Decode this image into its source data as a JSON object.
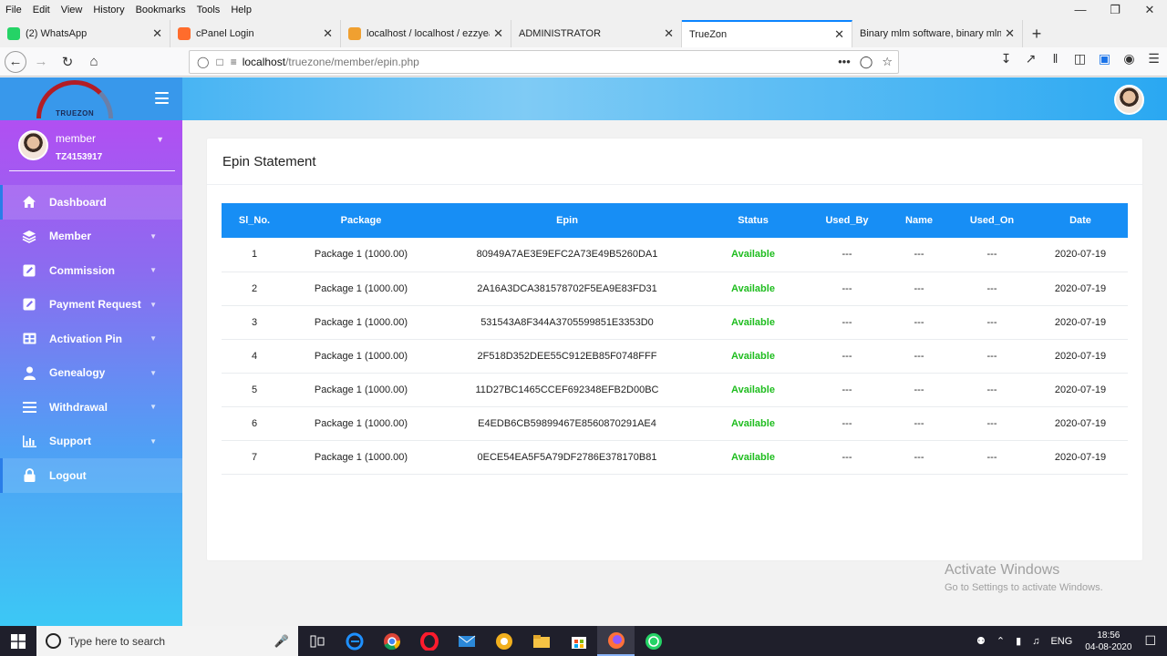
{
  "menubar": {
    "items": [
      "File",
      "Edit",
      "View",
      "History",
      "Bookmarks",
      "Tools",
      "Help"
    ]
  },
  "tabs": [
    {
      "label": "(2) WhatsApp",
      "icon": "whatsapp-icon",
      "color": "#25d366"
    },
    {
      "label": "cPanel Login",
      "icon": "cpanel-icon",
      "color": "#ff6c2c"
    },
    {
      "label": "localhost / localhost / ezzyeam",
      "icon": "phpmyadmin-icon",
      "color": "#f0a030"
    },
    {
      "label": "ADMINISTRATOR",
      "icon": "",
      "color": ""
    },
    {
      "label": "TrueZon",
      "icon": "",
      "color": ""
    },
    {
      "label": "Binary mlm software, binary mlm so",
      "icon": "",
      "color": ""
    }
  ],
  "urlbar": {
    "host": "localhost",
    "path": "/truezone/member/epin.php"
  },
  "brand": {
    "logo_text": "TRUEZON"
  },
  "user": {
    "name": "member",
    "id": "TZ4153917"
  },
  "sidebar": {
    "items": [
      {
        "label": "Dashboard",
        "icon": "home-icon",
        "has_sub": false
      },
      {
        "label": "Member",
        "icon": "layers-icon",
        "has_sub": true
      },
      {
        "label": "Commission",
        "icon": "edit-icon",
        "has_sub": true
      },
      {
        "label": "Payment Request",
        "icon": "edit-icon",
        "has_sub": true
      },
      {
        "label": "Activation Pin",
        "icon": "grid-icon",
        "has_sub": true
      },
      {
        "label": "Genealogy",
        "icon": "user-icon",
        "has_sub": true
      },
      {
        "label": "Withdrawal",
        "icon": "list-icon",
        "has_sub": true
      },
      {
        "label": "Support",
        "icon": "bar-chart-icon",
        "has_sub": true
      },
      {
        "label": "Logout",
        "icon": "lock-icon",
        "has_sub": false
      }
    ]
  },
  "card": {
    "title": "Epin Statement",
    "columns": [
      "Sl_No.",
      "Package",
      "Epin",
      "Status",
      "Used_By",
      "Name",
      "Used_On",
      "Date"
    ],
    "rows": [
      [
        "1",
        "Package 1 (1000.00)",
        "80949A7AE3E9EFC2A73E49B5260DA1",
        "Available",
        "---",
        "---",
        "---",
        "2020-07-19"
      ],
      [
        "2",
        "Package 1 (1000.00)",
        "2A16A3DCA381578702F5EA9E83FD31",
        "Available",
        "---",
        "---",
        "---",
        "2020-07-19"
      ],
      [
        "3",
        "Package 1 (1000.00)",
        "531543A8F344A3705599851E3353D0",
        "Available",
        "---",
        "---",
        "---",
        "2020-07-19"
      ],
      [
        "4",
        "Package 1 (1000.00)",
        "2F518D352DEE55C912EB85F0748FFF",
        "Available",
        "---",
        "---",
        "---",
        "2020-07-19"
      ],
      [
        "5",
        "Package 1 (1000.00)",
        "11D27BC1465CCEF692348EFB2D00BC",
        "Available",
        "---",
        "---",
        "---",
        "2020-07-19"
      ],
      [
        "6",
        "Package 1 (1000.00)",
        "E4EDB6CB59899467E8560870291AE4",
        "Available",
        "---",
        "---",
        "---",
        "2020-07-19"
      ],
      [
        "7",
        "Package 1 (1000.00)",
        "0ECE54EA5F5A79DF2786E378170B81",
        "Available",
        "---",
        "---",
        "---",
        "2020-07-19"
      ]
    ]
  },
  "watermark": {
    "line1": "Activate Windows",
    "line2": "Go to Settings to activate Windows."
  },
  "taskbar": {
    "search_placeholder": "Type here to search",
    "lang": "ENG",
    "time": "18:56",
    "date": "04-08-2020"
  }
}
